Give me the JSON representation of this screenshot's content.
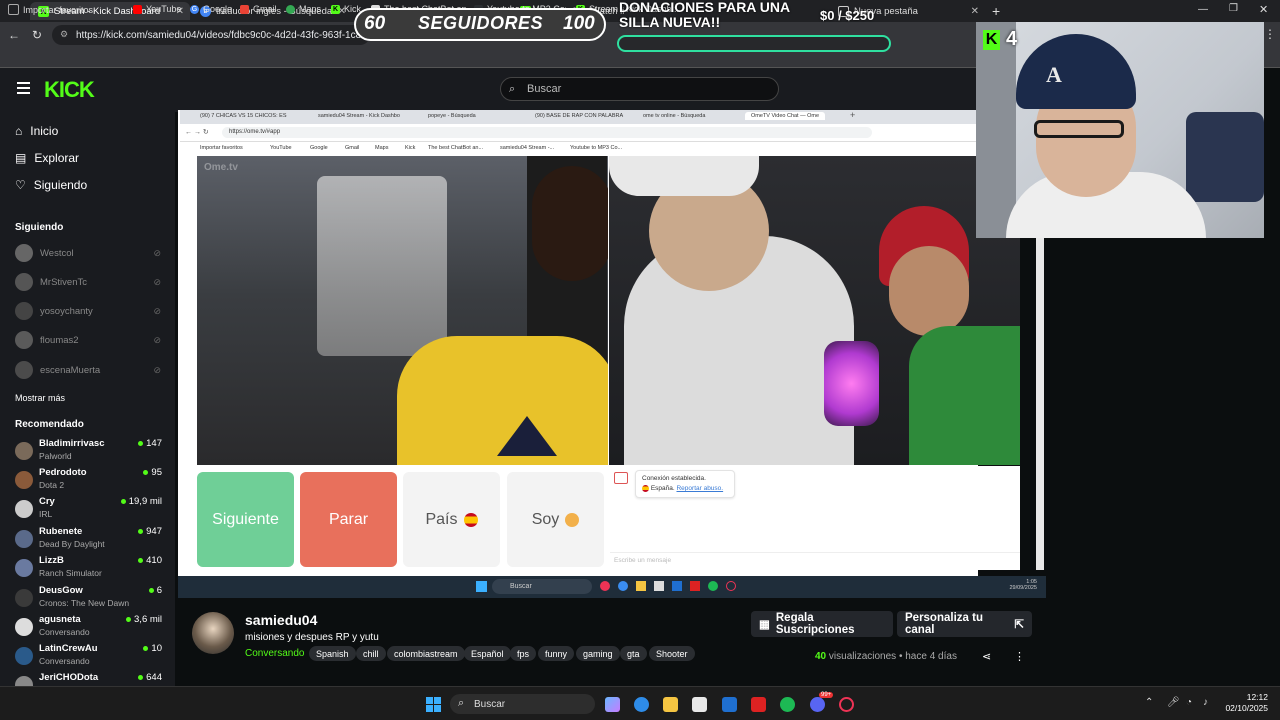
{
  "browser": {
    "tabs": [
      {
        "label": "Stream - Kick Dashboard",
        "icon": "kick-icon",
        "active": true
      },
      {
        "label": "traductor ingles - Búsqueda",
        "icon": "bing-icon"
      },
      {
        "label": "samiedu04 - Watch li",
        "icon": "kick-icon"
      },
      {
        "label": "Nueva pestaña",
        "icon": "newtab-icon"
      }
    ],
    "new_tab": "+",
    "url": "https://kick.com/samiedu04/videos/fdbc9c0c-4d2d-43fc-963f-1c8c9",
    "bookmarks": [
      "Importar favoritos",
      "YouTube",
      "Google",
      "Gmail",
      "Maps",
      "Kick",
      "The best ChatBot an...",
      "Youtube to MP3 Co...",
      "Stream - Kick Dashb..."
    ]
  },
  "overlay": {
    "seguidores_current": "60",
    "seguidores_label": "SEGUIDORES",
    "seguidores_goal": "100",
    "donaciones_title": "DONACIONES PARA UNA SILLA NUEVA!!",
    "donaciones_amount": "$0 / $250",
    "donaciones_progress": 0,
    "webcam_badge": "4"
  },
  "kick": {
    "logo": "KICK",
    "search_placeholder": "Buscar",
    "nav": [
      "Inicio",
      "Explorar",
      "Siguiendo"
    ],
    "following_title": "Siguiendo",
    "following": [
      "Westcol",
      "MrStivenTc",
      "yosoychanty",
      "floumas2",
      "escenaMuerta"
    ],
    "show_more": "Mostrar más",
    "recommended_title": "Recomendado",
    "recommended": [
      {
        "name": "Bladimirrivasc",
        "game": "Palworld",
        "viewers": "147"
      },
      {
        "name": "Pedrodoto",
        "game": "Dota 2",
        "viewers": "95"
      },
      {
        "name": "Cry",
        "game": "IRL",
        "viewers": "19,9 mil"
      },
      {
        "name": "Rubenete",
        "game": "Dead By Daylight",
        "viewers": "947"
      },
      {
        "name": "LizzB",
        "game": "Ranch Simulator",
        "viewers": "410"
      },
      {
        "name": "DeusGow",
        "game": "Cronos: The New Dawn",
        "viewers": "6"
      },
      {
        "name": "agusneta",
        "game": "Conversando",
        "viewers": "3,6 mil"
      },
      {
        "name": "LatinCrewAu",
        "game": "Conversando",
        "viewers": "10"
      },
      {
        "name": "JeriCHODota",
        "game": "",
        "viewers": "644"
      }
    ]
  },
  "inner_browser": {
    "tabs": [
      "(90) 7 CHICAS VS 15 CHICOS: ES",
      "samiedu04 Stream - Kick Dashbo",
      "popeye - Búsqueda",
      "(90) BASE DE RAP CON PALABRA",
      "ome tv online - Búsqueda",
      "OmeTV Video Chat — Ome"
    ],
    "url": "https://ome.tv/#app",
    "bookmarks": [
      "Importar favoritos",
      "YouTube",
      "Google",
      "Gmail",
      "Maps",
      "Kick",
      "The best ChatBot an...",
      "samiedu04 Stream -...",
      "Youtube to MP3 Co..."
    ],
    "watermark": "Ome.tv",
    "buttons": {
      "next": "Siguiente",
      "stop": "Parar",
      "country": "País",
      "gender": "Soy"
    },
    "chat_status": "Conexión establecida.",
    "chat_country": "España.",
    "chat_report": "Reportar abuso.",
    "chat_placeholder": "Escribe un mensaje",
    "taskbar_search": "Buscar",
    "clock_time": "1:05",
    "clock_date": "29/09/2025"
  },
  "stream": {
    "channel": "samiedu04",
    "title": "misiones y despues RP y yutu",
    "category": "Conversando",
    "tags": [
      "Spanish",
      "chill",
      "colombiastream",
      "Español",
      "fps",
      "funny",
      "gaming",
      "gta",
      "Shooter"
    ],
    "gift_button": "Regala Suscripciones",
    "customize_button": "Personaliza tu canal",
    "views_count": "40",
    "views_label": "visualizaciones",
    "time_ago": "hace 4 días"
  },
  "taskbar": {
    "search": "Buscar",
    "time": "12:12",
    "date": "02/10/2025",
    "notif_badge": "99+"
  }
}
